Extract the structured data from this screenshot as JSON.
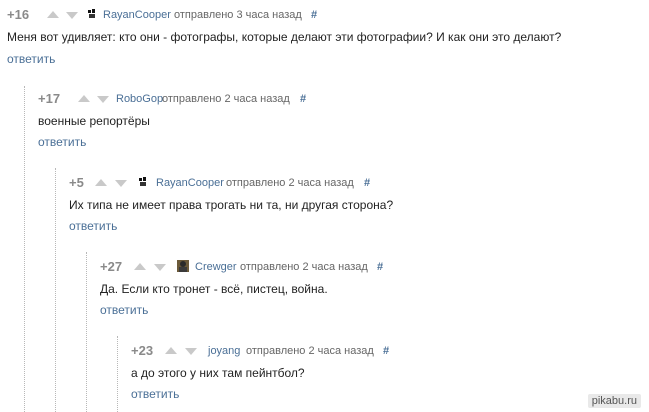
{
  "comments": [
    {
      "rating": "+16",
      "author": "RayanCooper",
      "sent": "отправлено 3 часа назад",
      "hash": "#",
      "text": "Меня вот удивляет: кто они - фотографы, которые делают эти фотографии? И как они это делают?",
      "reply": "ответить",
      "avatar": "dog-avatar-icon"
    },
    {
      "rating": "+17",
      "author": "RoboGop",
      "sent": "отправлено 2 часа назад",
      "hash": "#",
      "text": "военные репортёры",
      "reply": "ответить",
      "avatar": ""
    },
    {
      "rating": "+5",
      "author": "RayanCooper",
      "sent": "отправлено 2 часа назад",
      "hash": "#",
      "text": "Их типа не имеет права трогать ни та, ни другая сторона?",
      "reply": "ответить",
      "avatar": "dog-avatar-icon"
    },
    {
      "rating": "+27",
      "author": "Crewger",
      "sent": "отправлено 2 часа назад",
      "hash": "#",
      "text": "Да. Если кто тронет - всё, пистец, война.",
      "reply": "ответить",
      "avatar": "person-avatar-icon"
    },
    {
      "rating": "+23",
      "author": "joyang",
      "sent": "отправлено 2 часа назад",
      "hash": "#",
      "text": "а до этого у них там пейнтбол?",
      "reply": "ответить",
      "avatar": ""
    }
  ],
  "watermark": "pikabu.ru"
}
